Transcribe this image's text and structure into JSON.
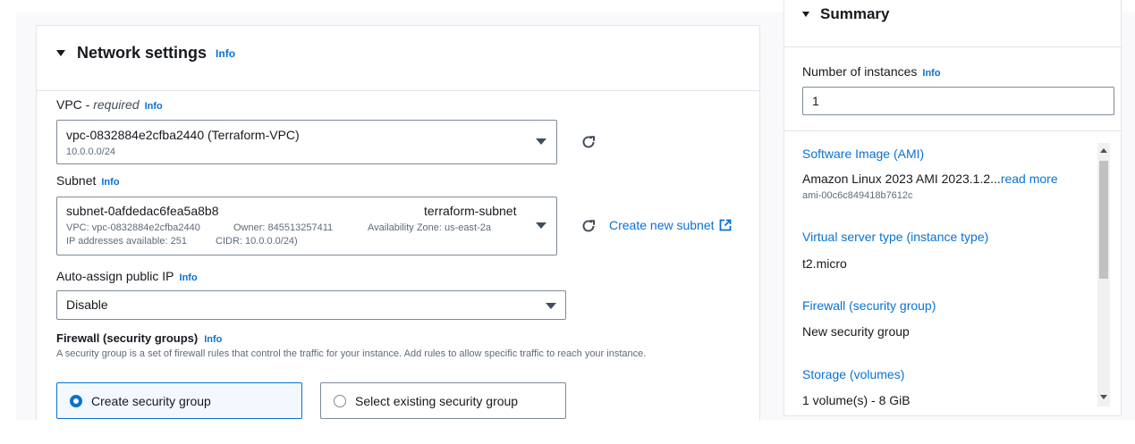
{
  "network": {
    "title": "Network settings",
    "info": "Info",
    "vpc": {
      "label": "VPC - ",
      "required": "required",
      "info": "Info",
      "value": "vpc-0832884e2cfba2440 (Terraform-VPC)",
      "sub": "10.0.0.0/24"
    },
    "subnet": {
      "label": "Subnet",
      "info": "Info",
      "id": "subnet-0afdedac6fea5a8b8",
      "name": "terraform-subnet",
      "vpc": "VPC: vpc-0832884e2cfba2440",
      "owner": "Owner: 845513257411",
      "az": "Availability Zone: us-east-2a",
      "ips": "IP addresses available: 251",
      "cidr": "CIDR: 10.0.0.0/24)",
      "create_link": "Create new subnet"
    },
    "public_ip": {
      "label": "Auto-assign public IP",
      "info": "Info",
      "value": "Disable"
    },
    "firewall": {
      "title": "Firewall (security groups)",
      "info": "Info",
      "description": "A security group is a set of firewall rules that control the traffic for your instance. Add rules to allow specific traffic to reach your instance.",
      "options": [
        {
          "label": "Create security group",
          "selected": true
        },
        {
          "label": "Select existing security group",
          "selected": false
        }
      ]
    }
  },
  "summary": {
    "title": "Summary",
    "instances_label": "Number of instances",
    "instances_info": "Info",
    "instances_value": "1",
    "ami_label": "Software Image (AMI)",
    "ami_value": "Amazon Linux 2023 AMI 2023.1.2...",
    "ami_read_more": "read more",
    "ami_id": "ami-00c6c849418b7612c",
    "type_label": "Virtual server type (instance type)",
    "type_value": "t2.micro",
    "firewall_label": "Firewall (security group)",
    "firewall_value": "New security group",
    "storage_label": "Storage (volumes)",
    "storage_value": "1 volume(s) - 8 GiB"
  },
  "colors": {
    "link": "#0972d3",
    "selected_tile_bg": "#f2f8fd"
  },
  "icons": [
    "caret-down-icon",
    "dropdown-arrow-icon",
    "refresh-icon",
    "external-link-icon",
    "radio-selected-icon",
    "radio-unselected-icon"
  ]
}
